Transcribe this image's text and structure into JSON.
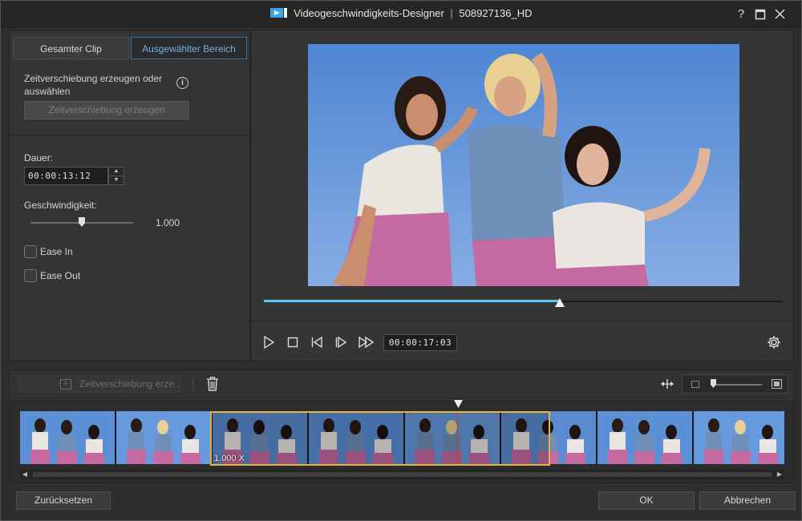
{
  "window": {
    "title": "Videogeschwindigkeits-Designer",
    "separator": "|",
    "file_name": "508927136_HD",
    "help_label": "?",
    "maximize_label": "☐",
    "close_label": "✕"
  },
  "tabs": [
    {
      "label": "Gesamter Clip",
      "active": false
    },
    {
      "label": "Ausgewählter Bereich",
      "active": true
    }
  ],
  "left_panel": {
    "instruction": "Zeitverschiebung erzeugen oder auswählen",
    "info_label": "i",
    "create_button": "Zeitverschiebung erzeugen",
    "duration_label": "Dauer:",
    "duration_value": "00:00:13:12",
    "speed_label": "Geschwindigkeit:",
    "speed_value": "1.000",
    "speed_level_fraction": 0.5,
    "ease_in_label": "Ease In",
    "ease_in_checked": false,
    "ease_out_label": "Ease Out",
    "ease_out_checked": false
  },
  "preview": {
    "progress_fraction": 0.57,
    "timecode": "00:00:17:03",
    "controls": [
      "play-icon",
      "stop-icon",
      "previous-frame-icon",
      "next-frame-icon",
      "fast-forward-icon"
    ],
    "settings_icon": "gear-icon"
  },
  "timeline": {
    "create_button": "Zeitverschiebung erze...",
    "selection_label": "1.000 X",
    "zoom_level_fraction": 0.05
  },
  "footer": {
    "reset_button": "Zurücksetzen",
    "ok_button": "OK",
    "cancel_button": "Abbrechen"
  },
  "colors": {
    "accent": "#5fc4f4",
    "active_tab_text": "#6cb4ee",
    "selection_border": "#e9b33a"
  }
}
